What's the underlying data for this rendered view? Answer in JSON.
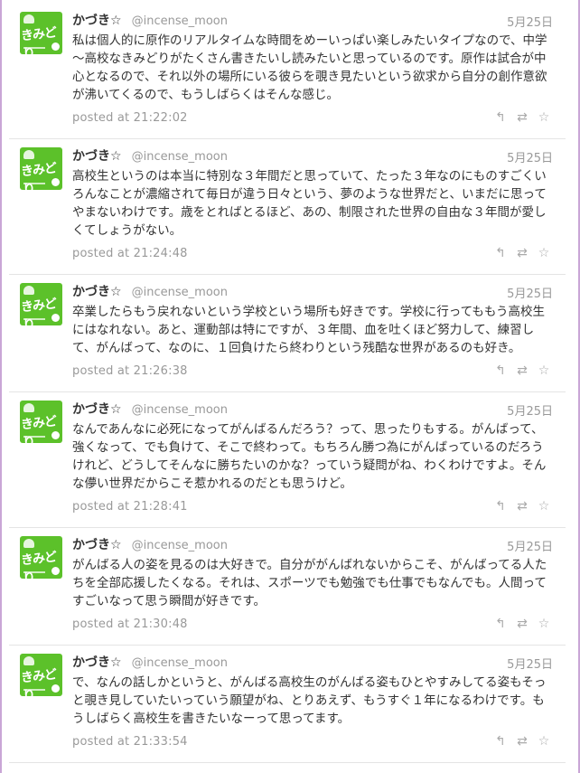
{
  "tweets": [
    {
      "name": "かづき☆",
      "handle": "@incense_moon",
      "date": "5月25日",
      "text": "私は個人的に原作のリアルタイムな時間をめーいっぱい楽しみたいタイプなので、中学～高校なきみどりがたくさん書きたいし読みたいと思っているのです。原作は試合が中心となるので、それ以外の場所にいる彼らを覗き見たいという欲求から自分の創作意欲が沸いてくるので、もうしばらくはそんな感じ。",
      "posted": "posted at 21:22:02"
    },
    {
      "name": "かづき☆",
      "handle": "@incense_moon",
      "date": "5月25日",
      "text": "高校生というのは本当に特別な３年間だと思っていて、たった３年なのにものすごくいろんなことが濃縮されて毎日が違う日々という、夢のような世界だと、いまだに思ってやまないわけです。歳をとればとるほど、あの、制限された世界の自由な３年間が愛しくてしょうがない。",
      "posted": "posted at 21:24:48"
    },
    {
      "name": "かづき☆",
      "handle": "@incense_moon",
      "date": "5月25日",
      "text": "卒業したらもう戻れないという学校という場所も好きです。学校に行ってももう高校生にはなれない。あと、運動部は特にですが、３年間、血を吐くほど努力して、練習して、がんばって、なのに、１回負けたら終わりという残酷な世界があるのも好き。",
      "posted": "posted at 21:26:38"
    },
    {
      "name": "かづき☆",
      "handle": "@incense_moon",
      "date": "5月25日",
      "text": "なんであんなに必死になってがんばるんだろう？って、思ったりもする。がんばって、強くなって、でも負けて、そこで終わって。もちろん勝つ為にがんばっているのだろうけれど、どうしてそんなに勝ちたいのかな？っていう疑問がね、わくわけですよ。そんな儚い世界だからこそ惹かれるのだとも思うけど。",
      "posted": "posted at 21:28:41"
    },
    {
      "name": "かづき☆",
      "handle": "@incense_moon",
      "date": "5月25日",
      "text": "がんばる人の姿を見るのは大好きで。自分ががんばれないからこそ、がんばってる人たちを全部応援したくなる。それは、スポーツでも勉強でも仕事でもなんでも。人間ってすごいなって思う瞬間が好きです。",
      "posted": "posted at 21:30:48"
    },
    {
      "name": "かづき☆",
      "handle": "@incense_moon",
      "date": "5月25日",
      "text": "で、なんの話しかというと、がんばる高校生のがんばる姿もひとやすみしてる姿もそっと覗き見していたいっていう願望がね、とりあえず、もうすぐ１年になるわけです。もうしばらく高校生を書きたいなーって思ってます。",
      "posted": "posted at 21:33:54"
    }
  ],
  "avatar": {
    "label": "きみどり",
    "color": "#5cc12a"
  },
  "icons": {
    "reply": "reply-icon",
    "retweet": "retweet-icon",
    "favorite": "star-icon"
  }
}
